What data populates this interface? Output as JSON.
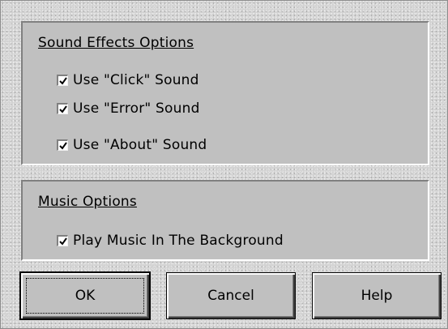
{
  "sound_effects": {
    "title": "Sound Effects Options",
    "options": [
      {
        "label": "Use \"Click\" Sound",
        "checked": true
      },
      {
        "label": "Use \"Error\" Sound",
        "checked": true
      },
      {
        "label": "Use \"About\" Sound",
        "checked": true
      }
    ]
  },
  "music": {
    "title": "Music Options",
    "options": [
      {
        "label": "Play Music In The Background",
        "checked": true
      }
    ]
  },
  "buttons": {
    "ok": "OK",
    "cancel": "Cancel",
    "help": "Help"
  },
  "colors": {
    "face": "#c0c0c0",
    "shadow": "#808080",
    "highlight": "#ffffff"
  },
  "icons": {
    "checkmark": "checkmark-icon"
  }
}
